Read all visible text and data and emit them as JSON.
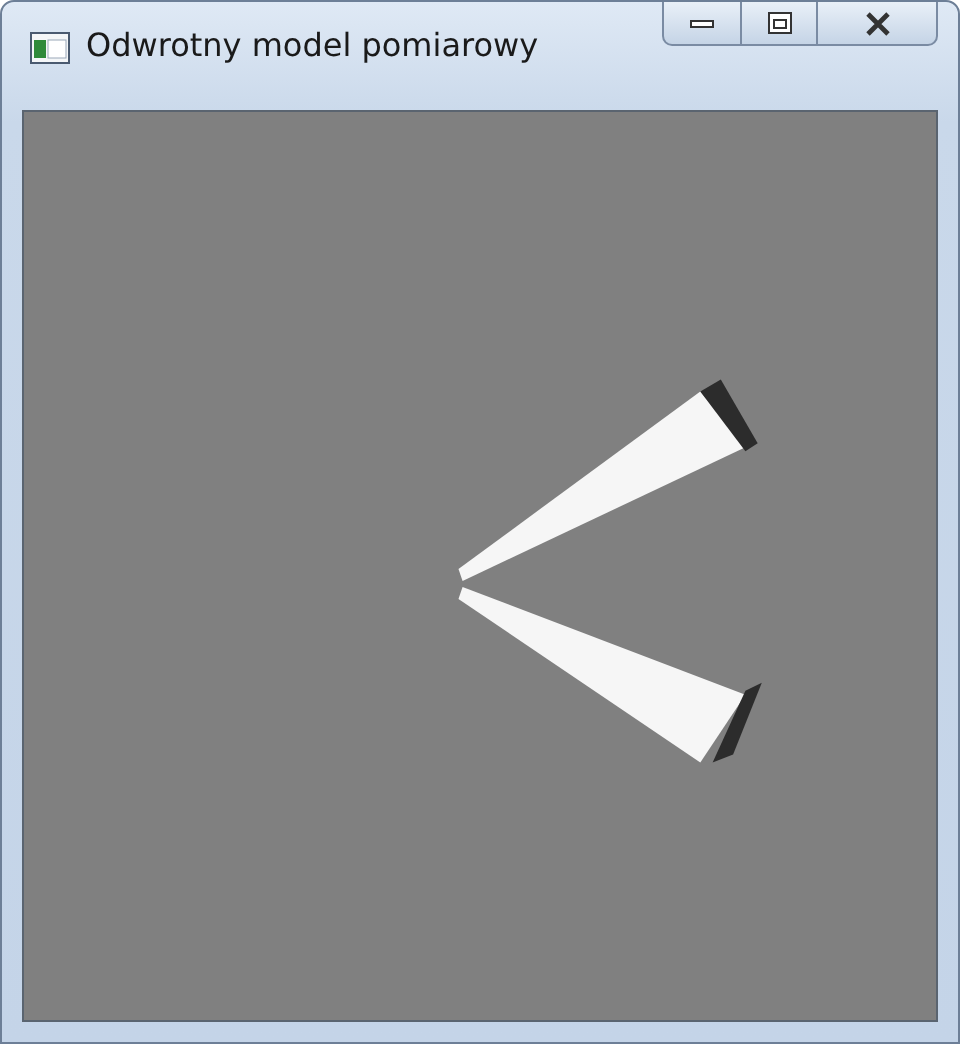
{
  "window": {
    "title": "Odwrotny model pomiarowy"
  }
}
